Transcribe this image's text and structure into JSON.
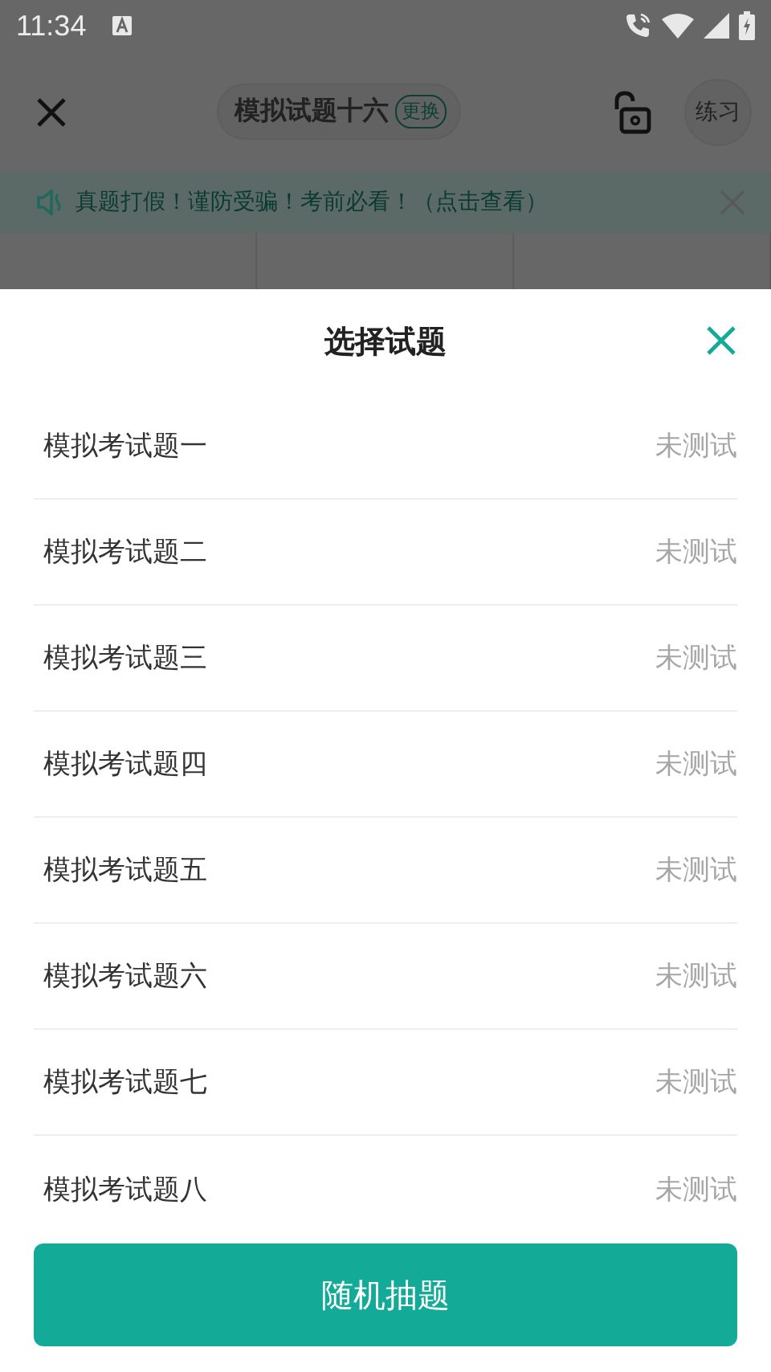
{
  "status_bar": {
    "time": "11:34"
  },
  "toolbar": {
    "title": "模拟试题十六",
    "change_label": "更换",
    "practice_label": "练习"
  },
  "notice": {
    "text": "真题打假！谨防受骗！考前必看！（点击查看）"
  },
  "sheet": {
    "title": "选择试题",
    "items": [
      {
        "name": "模拟考试题一",
        "status": "未测试"
      },
      {
        "name": "模拟考试题二",
        "status": "未测试"
      },
      {
        "name": "模拟考试题三",
        "status": "未测试"
      },
      {
        "name": "模拟考试题四",
        "status": "未测试"
      },
      {
        "name": "模拟考试题五",
        "status": "未测试"
      },
      {
        "name": "模拟考试题六",
        "status": "未测试"
      },
      {
        "name": "模拟考试题七",
        "status": "未测试"
      },
      {
        "name": "模拟考试题八",
        "status": "未测试"
      }
    ],
    "button": "随机抽题"
  }
}
